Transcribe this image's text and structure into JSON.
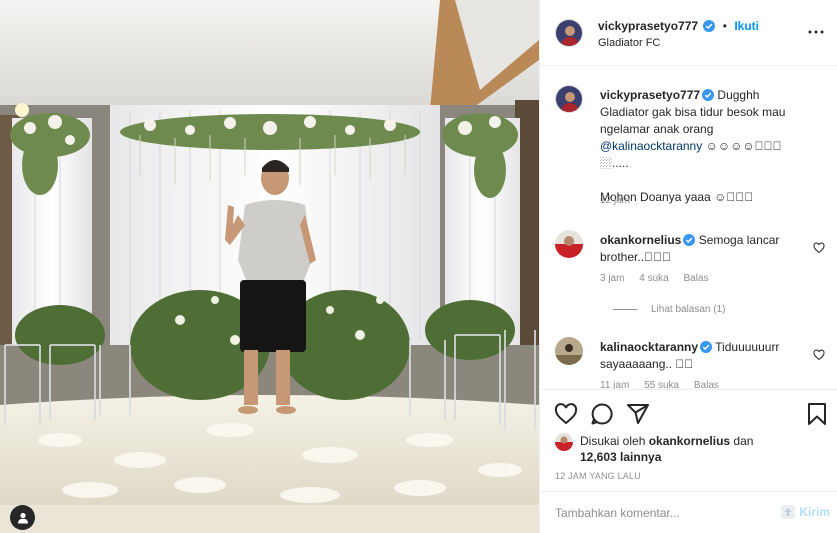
{
  "header": {
    "username": "vickyprasetyo777",
    "separator": "•",
    "follow_label": "Ikuti",
    "location": "Gladiator FC"
  },
  "caption": {
    "username": "vickyprasetyo777",
    "text_1": "Dugghh Gladiator gak bisa tidur besok mau ngelamar anak orang",
    "mention": "@kalinaocktaranny",
    "emoji_1": "☺☺☺☺🏼🏼🏼🏼.....",
    "text_2": "Mohon Doanya yaaa",
    "emoji_2": "☺🏼🏼🏼",
    "time": "12 jam"
  },
  "comments": [
    {
      "username": "okankornelius",
      "text": "Semoga lancar brother..🏼🏼🏼",
      "time": "3 jam",
      "likes": "4 suka",
      "reply_label": "Balas",
      "view_replies": "Lihat balasan (1)"
    },
    {
      "username": "kalinaocktaranny",
      "text": "Tiduuuuuurr sayaaaaang.. 🏼🏼",
      "time": "11 jam",
      "likes": "55 suka",
      "reply_label": "Balas"
    }
  ],
  "likes": {
    "prefix": "Disukai oleh",
    "user": "okankornelius",
    "and": "dan",
    "count_text": "12,603 lainnya"
  },
  "date_label": "12 JAM YANG LALU",
  "add_comment": {
    "placeholder": "Tambahkan komentar...",
    "send_label": "Kirim"
  },
  "icons": {
    "verified": "verified-badge-icon",
    "more": "more-options-icon",
    "like": "heart-icon",
    "comment": "comment-icon",
    "share": "share-icon",
    "save": "bookmark-icon",
    "tag": "user-tag-icon"
  },
  "colors": {
    "accent": "#0095f6",
    "verified": "#3897f0",
    "muted": "#8e8e8e",
    "mention": "#00376b",
    "send_disabled": "#b2dffc"
  }
}
